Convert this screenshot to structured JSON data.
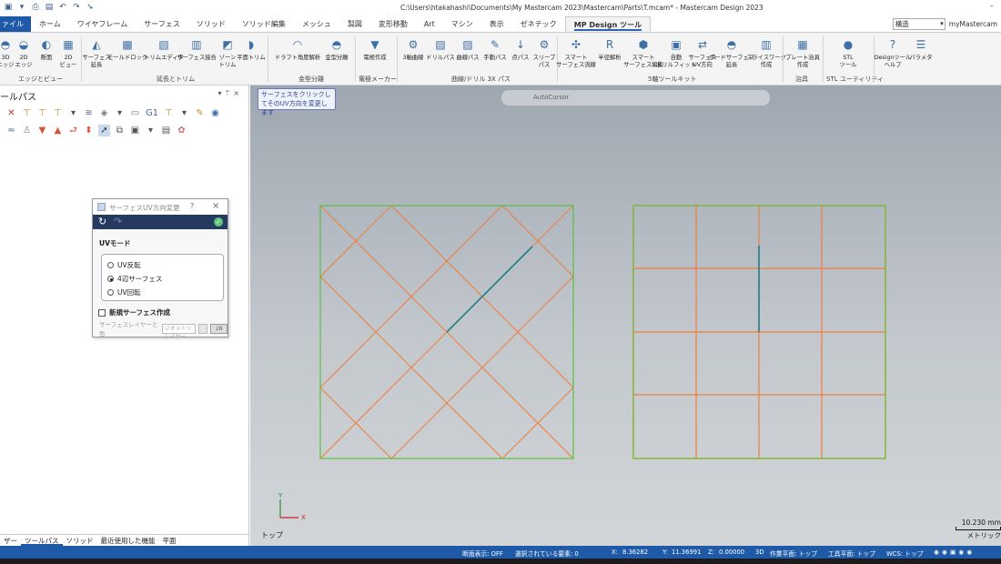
{
  "title_bar": {
    "window_title": "C:\\Users\\htakahashi\\Documents\\My Mastercam 2023\\Mastercam\\Parts\\T.mcam* - Mastercam Design 2023",
    "quick_access_icons": [
      "save-icon",
      "save-as-icon",
      "print-icon",
      "open-icon",
      "undo-icon",
      "redo-icon",
      "select-icon"
    ]
  },
  "ribbon_tabs": [
    "ァイル",
    "ホーム",
    "ワイヤフレーム",
    "サーフェス",
    "ソリッド",
    "ソリッド編集",
    "メッシュ",
    "製図",
    "変形移動",
    "Art",
    "マシン",
    "表示",
    "ゼネテック",
    "MP Design ツール"
  ],
  "ribbon_right": {
    "combo_value": "構造",
    "link": "myMastercam"
  },
  "ribbon_groups": [
    {
      "label": "エッジとビュー",
      "buttons": [
        "3D\nエッジ",
        "2D\nエッジ",
        "断面",
        "2D\nビュー"
      ]
    },
    {
      "label": "延長とトリム",
      "buttons": [
        "サーフェス\n延長",
        "モールドロック",
        "トリムエディタ",
        "サーフェス接合",
        "ゾーン\nトリム",
        "平面トリム"
      ]
    },
    {
      "label": "金型分離",
      "buttons": [
        "ドラフト角度解析",
        "金型分離"
      ]
    },
    {
      "label": "電極メーカー",
      "buttons": [
        "電極作成"
      ]
    },
    {
      "label": "曲線/ドリル 3X パス",
      "buttons": [
        "3軸曲線",
        "ドリルパス",
        "曲線パス",
        "手動パス",
        "点パス",
        "スリーブ\nパス"
      ]
    },
    {
      "label": "5軸ツールキット",
      "buttons": [
        "スマート\nサーフェス流線",
        "半径解析",
        "スマート\nサーフェス編集",
        "自動\nドリルフィット",
        "サーフェス\nUV方向",
        "ボードサーフェス\n延長",
        "スライスワーク\n作成"
      ]
    },
    {
      "label": "治具",
      "buttons": [
        "プレート治具\n作成"
      ]
    },
    {
      "label": "STL ユーティリティ",
      "buttons": [
        "STL\nツール"
      ]
    },
    {
      "label": "",
      "buttons": [
        "Designツール\nヘルプ",
        "パラメタ"
      ]
    }
  ],
  "left_panel": {
    "title": "ールパス",
    "bottom_tabs": [
      "ザー",
      "ツールパス",
      "ソリッド",
      "最近使用した機能",
      "平面"
    ],
    "active_tab": "ツールパス"
  },
  "dialog": {
    "title": "サーフェスUV方向変更",
    "help": "?",
    "section_label": "UVモード",
    "options": [
      "UV反転",
      "4辺サーフェス",
      "UV回転"
    ],
    "selected_option": "4辺サーフェス",
    "checkbox_label": "新規サーフェス作成",
    "layer_label": "サーフェスレイヤーと色",
    "layer_placeholder": "ジオメトリレイヤー",
    "layer_button": "28"
  },
  "viewport": {
    "tooltip": "サーフェスをクリックしてそのUV方向を変更します",
    "autocursor_label": "AutoCursor",
    "view_name": "トップ",
    "scale_value": "10.230 mm",
    "scale_unit": "メトリック",
    "axis_x": "X",
    "axis_y": "Y",
    "colors": {
      "left_boundary": "#56c43c",
      "right_boundary": "#7eb52e",
      "flowlines": "#ef7d3c",
      "uv_direction": "#1f7f8c"
    }
  },
  "status_bar": {
    "section_view": "断面表示: OFF",
    "selected": "選択されている要素: 0",
    "x_label": "X:",
    "x_value": "8.36282",
    "y_label": "Y:",
    "y_value": "11.36991",
    "z_label": "Z:",
    "z_value": "0.00000",
    "mode": "3D",
    "cplane": "作業平面: トップ",
    "tplane": "工具平面: トップ",
    "wcs": "WCS: トップ"
  }
}
